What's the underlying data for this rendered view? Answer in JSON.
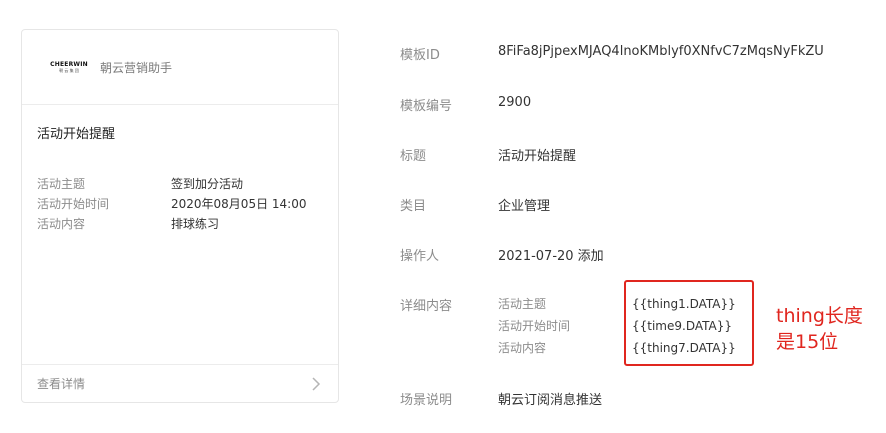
{
  "preview": {
    "brand_logo_text": "CHEERWIN",
    "brand_logo_sub": "朝 云 集 团",
    "brand_name": "朝云营销助手",
    "message_title": "活动开始提醒",
    "fields": [
      {
        "key": "活动主题",
        "value": "签到加分活动"
      },
      {
        "key": "活动开始时间",
        "value": "2020年08月05日 14:00"
      },
      {
        "key": "活动内容",
        "value": "排球练习"
      }
    ],
    "footer_label": "查看详情",
    "footer_icon": "chevron-right-icon"
  },
  "info": {
    "template_id_label": "模板ID",
    "template_id": "8FiFa8jPjpexMJAQ4lnoKMblyf0XNfvC7zMqsNyFkZU",
    "template_no_label": "模板编号",
    "template_no": "2900",
    "title_label": "标题",
    "title": "活动开始提醒",
    "category_label": "类目",
    "category": "企业管理",
    "operator_label": "操作人",
    "operator": "2021-07-20 添加",
    "detail_label": "详细内容",
    "details": [
      {
        "key": "活动主题",
        "value": "{{thing1.DATA}}"
      },
      {
        "key": "活动开始时间",
        "value": "{{time9.DATA}}"
      },
      {
        "key": "活动内容",
        "value": "{{thing7.DATA}}"
      }
    ],
    "scene_label": "场景说明",
    "scene": "朝云订阅消息推送"
  },
  "annotation": {
    "line1": "thing长度",
    "line2": "是15位",
    "color": "#e0261f"
  }
}
